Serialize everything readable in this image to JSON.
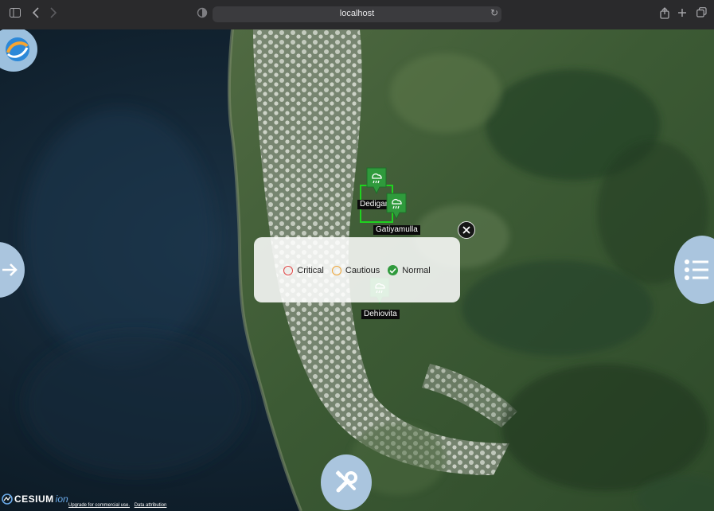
{
  "browser": {
    "url": "localhost",
    "icons": {
      "sidebar": "sidebar-icon",
      "back": "chevron-left-icon",
      "forward": "chevron-right-icon",
      "shield": "privacy-shield-icon",
      "reload": "reload-icon",
      "share": "share-icon",
      "new_tab": "plus-icon",
      "tabs": "tabs-overview-icon"
    }
  },
  "map": {
    "markers": [
      {
        "label": "Dedigan",
        "status": "Normal"
      },
      {
        "label": "Gatiyamulla",
        "status": "Normal"
      },
      {
        "label": "Dehiovita",
        "status": "Normal"
      }
    ],
    "colors": {
      "normal": "#2f9a3c",
      "selection": "#1fd21f"
    }
  },
  "legend": {
    "items": [
      {
        "label": "Critical",
        "color": "#e04646"
      },
      {
        "label": "Cautious",
        "color": "#f0a73a"
      },
      {
        "label": "Normal",
        "color": "#2f9a3c"
      }
    ]
  },
  "controls": {
    "logo": "app-logo-icon",
    "toggle_panel": "arrow-right-icon",
    "list": "list-icon",
    "tools": "tools-icon"
  },
  "footer": {
    "brand": "CESIUM",
    "brand_suffix": "ion",
    "upgrade_link": "Upgrade for commercial use.",
    "attribution_link": "Data attribution"
  }
}
